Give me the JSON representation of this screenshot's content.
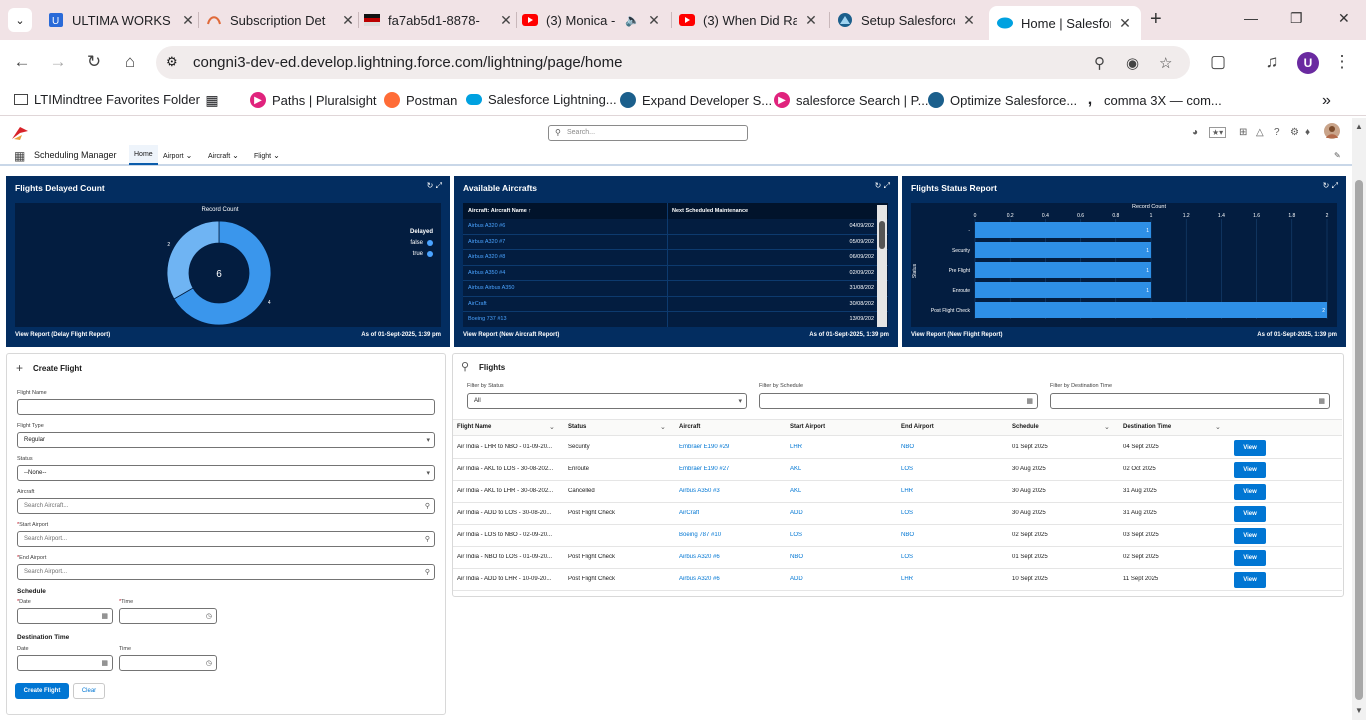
{
  "browser": {
    "tabs": [
      {
        "title": "ULTIMA WORKS",
        "favicon": "ultima-icon",
        "color": "#2a6ad8"
      },
      {
        "title": "Subscription Det",
        "favicon": "subscription-icon",
        "color": "#e06a3a"
      },
      {
        "title": "fa7ab5d1-8878-",
        "favicon": "flag-icon",
        "color": "#111111"
      },
      {
        "title": "(3) Monica -",
        "favicon": "youtube-icon",
        "color": "#ff0000"
      },
      {
        "title": "(3) When Did Ra",
        "favicon": "youtube-icon",
        "color": "#ff0000"
      },
      {
        "title": "Setup Salesforce",
        "favicon": "trailhead-icon",
        "color": "#1b5f8c"
      },
      {
        "title": "Home | Salesforc",
        "favicon": "salesforce-cloud-icon",
        "color": "#00a1e0"
      }
    ],
    "url": "congni3-dev-ed.develop.lightning.force.com/lightning/page/home",
    "profile_initial": "U",
    "bookmarks": [
      {
        "label": "LTIMindtree Favorites Folder",
        "icon": "folder-icon"
      },
      {
        "label": "",
        "icon": "apps-grid-icon"
      },
      {
        "label": "Paths | Pluralsight",
        "icon": "pluralsight-icon"
      },
      {
        "label": "Postman",
        "icon": "postman-icon"
      },
      {
        "label": "Salesforce Lightning...",
        "icon": "salesforce-cloud-icon"
      },
      {
        "label": "Expand Developer S...",
        "icon": "trailhead-icon"
      },
      {
        "label": "salesforce Search | P...",
        "icon": "pluralsight-icon"
      },
      {
        "label": "Optimize Salesforce...",
        "icon": "trailhead-icon"
      },
      {
        "label": "comma 3X — com...",
        "icon": "comma-icon"
      }
    ]
  },
  "sf": {
    "search_placeholder": "Search...",
    "app_name": "Scheduling Manager",
    "nav": [
      "Home",
      "Airport",
      "Aircraft",
      "Flight"
    ]
  },
  "dashboards": {
    "delayed": {
      "title": "Flights Delayed Count",
      "chart_label": "Record Count",
      "legend_title": "Delayed",
      "legend": [
        {
          "label": "false",
          "color": "#4aa3ff"
        },
        {
          "label": "true",
          "color": "#4aa3ff"
        }
      ],
      "total": "6",
      "footer": "View Report (Delay Flight Report)",
      "asof": "As of 01-Sept-2025, 1:39 pm"
    },
    "aircrafts": {
      "title": "Available Aircrafts",
      "col1": "Aircraft: Aircraft Name",
      "col2": "Next Scheduled Maintenance",
      "rows": [
        {
          "name": "Airbus A320 #6",
          "date": "04/09/202"
        },
        {
          "name": "Airbus A320 #7",
          "date": "05/09/202"
        },
        {
          "name": "Airbus A320 #8",
          "date": "06/09/202"
        },
        {
          "name": "Airbus A350 #4",
          "date": "02/09/202"
        },
        {
          "name": "Airbus Airbus A350",
          "date": "31/08/202"
        },
        {
          "name": "AirCraft",
          "date": "30/08/202"
        },
        {
          "name": "Boeing 737 #13",
          "date": "13/09/202"
        }
      ],
      "footer": "View Report (New Aircraft Report)",
      "asof": "As of 01-Sept-2025, 1:39 pm"
    },
    "status": {
      "title": "Flights Status Report",
      "footer": "View Report (New Flight Report)",
      "asof": "As of 01-Sept-2025, 1:39 pm"
    }
  },
  "chart_data": [
    {
      "type": "pie",
      "title": "Flights Delayed Count",
      "subtitle": "Record Count",
      "legend_title": "Delayed",
      "categories": [
        "false",
        "true"
      ],
      "values": [
        4,
        2
      ],
      "center_label": "6",
      "legend_position": "right"
    },
    {
      "type": "bar",
      "orientation": "horizontal",
      "title": "Flights Status Report",
      "xlabel": "Record Count",
      "ylabel": "Status",
      "categories": [
        "-",
        "Security",
        "Pre Flight",
        "Enroute",
        "Post Flight Check"
      ],
      "values": [
        1,
        1,
        1,
        1,
        2
      ],
      "xlim": [
        0,
        2
      ],
      "xticks": [
        "0",
        "0.2",
        "0.4",
        "0.6",
        "0.8",
        "1",
        "1.2",
        "1.4",
        "1.6",
        "1.8",
        "2"
      ],
      "grid": true
    }
  ],
  "create_flight": {
    "title": "Create Flight",
    "flight_name_label": "Flight Name",
    "flight_name_value": "",
    "flight_type_label": "Flight Type",
    "flight_type_value": "Regular",
    "status_label": "Status",
    "status_value": "--None--",
    "aircraft_label": "Aircraft",
    "aircraft_placeholder": "Search Aircraft...",
    "start_airport_label": "Start Airport",
    "start_airport_placeholder": "Search Airport...",
    "end_airport_label": "End Airport",
    "end_airport_placeholder": "Search Airport...",
    "schedule_heading": "Schedule",
    "date_label": "Date",
    "time_label": "Time",
    "destination_heading": "Destination Time",
    "create_button": "Create Flight",
    "clear_button": "Clear"
  },
  "flights": {
    "title": "Flights",
    "filter_status_label": "Filter by Status",
    "filter_status_value": "All",
    "filter_schedule_label": "Filter by Schedule",
    "filter_destination_label": "Filter by Destination Time",
    "columns": [
      "Flight Name",
      "Status",
      "Aircraft",
      "Start Airport",
      "End Airport",
      "Schedule",
      "Destination Time"
    ],
    "view_label": "View",
    "rows": [
      {
        "name": "Air India - LHR to NBO - 01-09-20...",
        "status": "Security",
        "aircraft": "Embraer E190 #29",
        "start": "LHR",
        "end": "NBO",
        "schedule": "01 Sept 2025",
        "dest": "04 Sept 2025"
      },
      {
        "name": "Air India - AKL to LOS - 30-08-202...",
        "status": "Enroute",
        "aircraft": "Embraer E190 #27",
        "start": "AKL",
        "end": "LOS",
        "schedule": "30 Aug 2025",
        "dest": "02 Oct 2025"
      },
      {
        "name": "Air India - AKL to LHR - 30-08-202...",
        "status": "Cancelled",
        "aircraft": "Airbus A350 #3",
        "start": "AKL",
        "end": "LHR",
        "schedule": "30 Aug 2025",
        "dest": "31 Aug 2025"
      },
      {
        "name": "Air India - ADD to LOS - 30-08-20...",
        "status": "Post Flight Check",
        "aircraft": "AirCraft",
        "start": "ADD",
        "end": "LOS",
        "schedule": "30 Aug 2025",
        "dest": "31 Aug 2025"
      },
      {
        "name": "Air India - LOS to NBO - 02-09-20...",
        "status": "",
        "aircraft": "Boeing 787 #10",
        "start": "LOS",
        "end": "NBO",
        "schedule": "02 Sept 2025",
        "dest": "03 Sept 2025"
      },
      {
        "name": "Air India - NBO to LOS - 01-09-20...",
        "status": "Post Flight Check",
        "aircraft": "Airbus A320 #6",
        "start": "NBO",
        "end": "LOS",
        "schedule": "01 Sept 2025",
        "dest": "02 Sept 2025"
      },
      {
        "name": "Air India - ADD to LHR - 10-09-20...",
        "status": "Post Flight Check",
        "aircraft": "Airbus A320 #6",
        "start": "ADD",
        "end": "LHR",
        "schedule": "10 Sept 2025",
        "dest": "11 Sept 2025"
      }
    ]
  }
}
